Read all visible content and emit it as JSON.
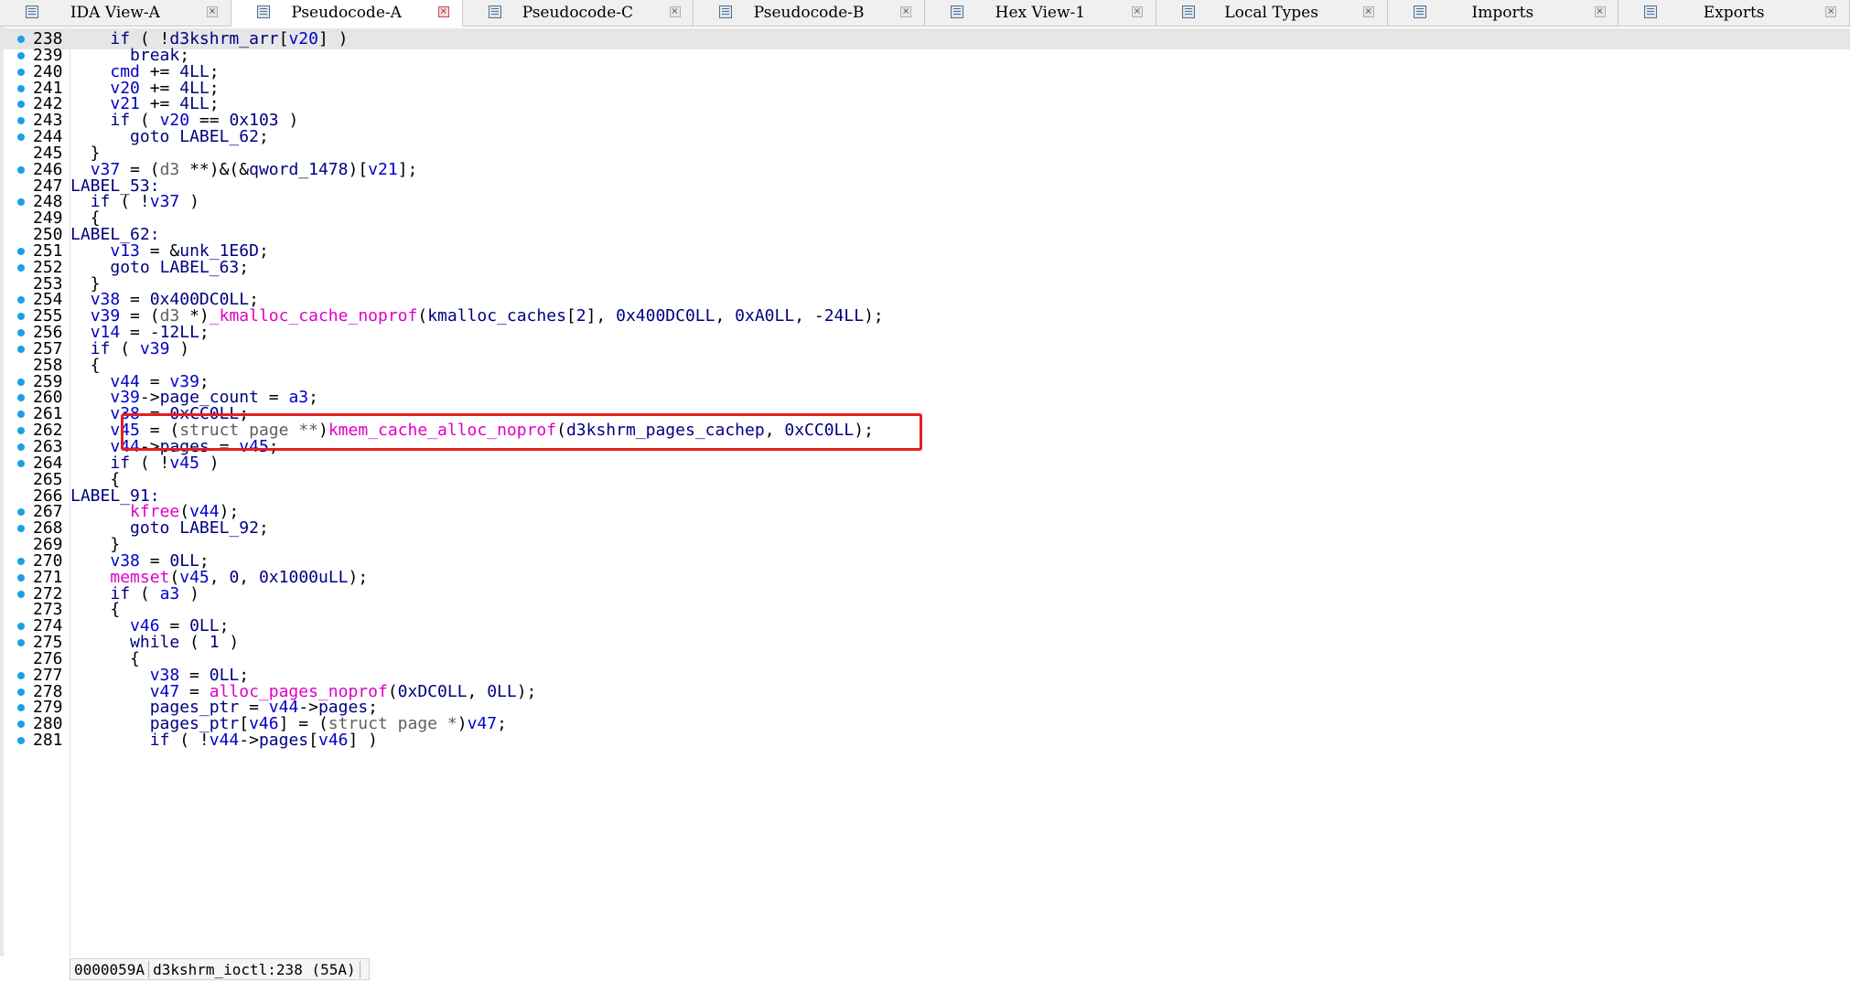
{
  "tabs": [
    {
      "label": "IDA View-A",
      "active": false,
      "icon": "disassembly-view-icon"
    },
    {
      "label": "Pseudocode-A",
      "active": true,
      "icon": "pseudocode-icon"
    },
    {
      "label": "Pseudocode-C",
      "active": false,
      "icon": "pseudocode-icon"
    },
    {
      "label": "Pseudocode-B",
      "active": false,
      "icon": "pseudocode-icon"
    },
    {
      "label": "Hex View-1",
      "active": false,
      "icon": "hex-view-icon"
    },
    {
      "label": "Local Types",
      "active": false,
      "icon": "local-types-icon"
    },
    {
      "label": "Imports",
      "active": false,
      "icon": "imports-icon"
    },
    {
      "label": "Exports",
      "active": false,
      "icon": "exports-icon"
    }
  ],
  "tab_close_glyph": "×",
  "code": {
    "current_line": "238",
    "highlighted_line": "262",
    "lines": [
      {
        "n": "238",
        "bp": true,
        "text": "    if ( !d3kshrm_arr[v20] )"
      },
      {
        "n": "239",
        "bp": true,
        "text": "      break;"
      },
      {
        "n": "240",
        "bp": true,
        "text": "    cmd += 4LL;"
      },
      {
        "n": "241",
        "bp": true,
        "text": "    v20 += 4LL;"
      },
      {
        "n": "242",
        "bp": true,
        "text": "    v21 += 4LL;"
      },
      {
        "n": "243",
        "bp": true,
        "text": "    if ( v20 == 0x103 )"
      },
      {
        "n": "244",
        "bp": true,
        "text": "      goto LABEL_62;"
      },
      {
        "n": "245",
        "bp": false,
        "text": "  }"
      },
      {
        "n": "246",
        "bp": true,
        "text": "  v37 = (d3 **)&(&qword_1478)[v21];"
      },
      {
        "n": "247",
        "bp": false,
        "text": "LABEL_53:"
      },
      {
        "n": "248",
        "bp": true,
        "text": "  if ( !v37 )"
      },
      {
        "n": "249",
        "bp": false,
        "text": "  {"
      },
      {
        "n": "250",
        "bp": false,
        "text": "LABEL_62:"
      },
      {
        "n": "251",
        "bp": true,
        "text": "    v13 = &unk_1E6D;"
      },
      {
        "n": "252",
        "bp": true,
        "text": "    goto LABEL_63;"
      },
      {
        "n": "253",
        "bp": false,
        "text": "  }"
      },
      {
        "n": "254",
        "bp": true,
        "text": "  v38 = 0x400DC0LL;"
      },
      {
        "n": "255",
        "bp": true,
        "text": "  v39 = (d3 *)_kmalloc_cache_noprof(kmalloc_caches[2], 0x400DC0LL, 0xA0LL, -24LL);"
      },
      {
        "n": "256",
        "bp": true,
        "text": "  v14 = -12LL;"
      },
      {
        "n": "257",
        "bp": true,
        "text": "  if ( v39 )"
      },
      {
        "n": "258",
        "bp": false,
        "text": "  {"
      },
      {
        "n": "259",
        "bp": true,
        "text": "    v44 = v39;"
      },
      {
        "n": "260",
        "bp": true,
        "text": "    v39->page_count = a3;"
      },
      {
        "n": "261",
        "bp": true,
        "text": "    v38 = 0xCC0LL;"
      },
      {
        "n": "262",
        "bp": true,
        "text": "    v45 = (struct page **)kmem_cache_alloc_noprof(d3kshrm_pages_cachep, 0xCC0LL);"
      },
      {
        "n": "263",
        "bp": true,
        "text": "    v44->pages = v45;"
      },
      {
        "n": "264",
        "bp": true,
        "text": "    if ( !v45 )"
      },
      {
        "n": "265",
        "bp": false,
        "text": "    {"
      },
      {
        "n": "266",
        "bp": false,
        "text": "LABEL_91:"
      },
      {
        "n": "267",
        "bp": true,
        "text": "      kfree(v44);"
      },
      {
        "n": "268",
        "bp": true,
        "text": "      goto LABEL_92;"
      },
      {
        "n": "269",
        "bp": false,
        "text": "    }"
      },
      {
        "n": "270",
        "bp": true,
        "text": "    v38 = 0LL;"
      },
      {
        "n": "271",
        "bp": true,
        "text": "    memset(v45, 0, 0x1000uLL);"
      },
      {
        "n": "272",
        "bp": true,
        "text": "    if ( a3 )"
      },
      {
        "n": "273",
        "bp": false,
        "text": "    {"
      },
      {
        "n": "274",
        "bp": true,
        "text": "      v46 = 0LL;"
      },
      {
        "n": "275",
        "bp": true,
        "text": "      while ( 1 )"
      },
      {
        "n": "276",
        "bp": false,
        "text": "      {"
      },
      {
        "n": "277",
        "bp": true,
        "text": "        v38 = 0LL;"
      },
      {
        "n": "278",
        "bp": true,
        "text": "        v47 = alloc_pages_noprof(0xDC0LL, 0LL);"
      },
      {
        "n": "279",
        "bp": true,
        "text": "        pages_ptr = v44->pages;"
      },
      {
        "n": "280",
        "bp": true,
        "text": "        pages_ptr[v46] = (struct page *)v47;"
      },
      {
        "n": "281",
        "bp": true,
        "text": "        if ( !v44->pages[v46] )"
      }
    ]
  },
  "statusbar": {
    "address": "0000059A",
    "location": "d3kshrm_ioctl:238 (55A)",
    "extra": ""
  },
  "colors": {
    "keyword": "#000080",
    "variable": "#0000c8",
    "function": "#e000c8",
    "type": "#606060",
    "breakpoint": "#1aa0e6",
    "highlight_box": "#e02020"
  }
}
